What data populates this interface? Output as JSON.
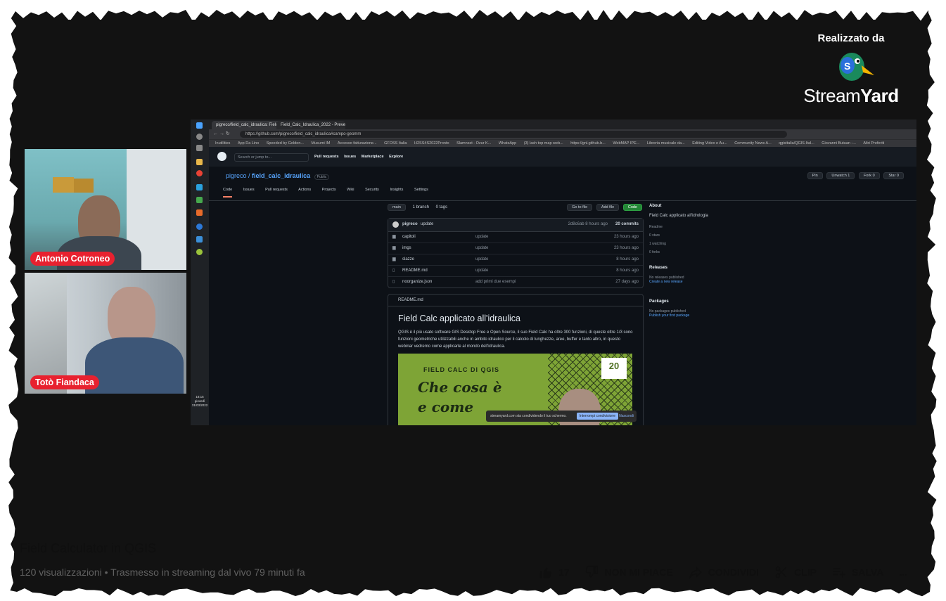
{
  "branding": {
    "label": "Realizzato da",
    "name_regular": "Stream",
    "name_bold": "Yard"
  },
  "participants": [
    {
      "name": "Antonio Cotroneo"
    },
    {
      "name": "Totò Fiandaca"
    }
  ],
  "screen": {
    "tabs": [
      "pigreco/field_calc_idraulica: Field...",
      "Field_Calc_Idraulica_2022 - Preve..."
    ],
    "url": "https://github.com/pigreco/field_calc_idraulica#campo-geomm",
    "bookmarks": [
      "Inutilities",
      "App Da Lino",
      "Speeded by Golden...",
      "Musumi IM",
      "Accesso fatturazione...",
      "GFOSS Italia",
      "H2SS4S2022Pronto",
      "Slamnsst - Ozur K...",
      "WhatsApp",
      "(3) lash top map web...",
      "https://gnl.github.b...",
      "WebMAP IPE...",
      "Libreria musicale da...",
      "Editing Video e Au...",
      "Community News A...",
      "qgisitalia/QGIS-Ital...",
      "Giovanni Butuan -...",
      "Altri Preferiti"
    ],
    "github": {
      "search_placeholder": "Search or jump to...",
      "nav": [
        "Pull requests",
        "Issues",
        "Marketplace",
        "Explore"
      ],
      "owner": "pigreco",
      "repo": "field_calc_idraulica",
      "visibility": "Public",
      "repo_tabs": [
        "Code",
        "Issues",
        "Pull requests",
        "Actions",
        "Projects",
        "Wiki",
        "Security",
        "Insights",
        "Settings"
      ],
      "repo_buttons": [
        "Pin",
        "Unwatch 1",
        "Fork 0",
        "Star 0"
      ],
      "branch": "main",
      "branches": "1 branch",
      "tags": "0 tags",
      "go_to_file": "Go to file",
      "add_file": "Add file",
      "code_button": "Code",
      "commit_author": "pigreco",
      "commit_msg": "update",
      "commit_meta": "2d8c6ab 8 hours ago",
      "commits": "20 commits",
      "files": [
        {
          "name": "capitoli",
          "msg": "update",
          "time": "23 hours ago"
        },
        {
          "name": "imgs",
          "msg": "update",
          "time": "23 hours ago"
        },
        {
          "name": "slazze",
          "msg": "update",
          "time": "8 hours ago"
        },
        {
          "name": "README.md",
          "msg": "update",
          "time": "8 hours ago"
        },
        {
          "name": "noorganize.json",
          "msg": "add primi due esempi",
          "time": "27 days ago"
        }
      ],
      "readme_label": "README.md",
      "readme_title": "Field Calc applicato all'idraulica",
      "readme_text": "QGIS è il più usato software GIS Desktop Free e Open Source, il suo Field Calc ha oltre 300 funzioni, di queste oltre 1/3 sono funzioni geometriche utilizzabili anche in ambito idraulico per il calcolo di lunghezze, aree, buffer e tanto altro, in questo webinar vedremo come applicarle al mondo dell'idraulica.",
      "banner_kicker": "FIELD CALC DI QGIS",
      "banner_headline_1": "Che cosa è",
      "banner_headline_2": "e come",
      "banner_badge": "20",
      "about_title": "About",
      "about_text": "Field Calc applicato all'idrologia",
      "about_meta": [
        "Readme",
        "0 stars",
        "1 watching",
        "0 forks"
      ],
      "releases_title": "Releases",
      "releases_text": "No releases published",
      "releases_link": "Create a new release",
      "packages_title": "Packages",
      "packages_text": "No packages published",
      "packages_link": "Publish your first package"
    },
    "share_notice": "streamyard.com sta condividendo il tuo schermo.",
    "share_stop": "Interrompi condivisione",
    "share_hide": "Nascondi",
    "clock_time": "18:15",
    "clock_day": "giovedì",
    "clock_date": "31/03/2022"
  },
  "video": {
    "title": "Field Calculator in QGIS",
    "stats": "120 visualizzazioni • Trasmesso in streaming dal vivo 79 minuti fa",
    "likes": "17",
    "dislike_label": "NON MI PIACE",
    "share_label": "CONDIVIDI",
    "clip_label": "CLIP",
    "save_label": "SALVA",
    "more_label": "..."
  }
}
